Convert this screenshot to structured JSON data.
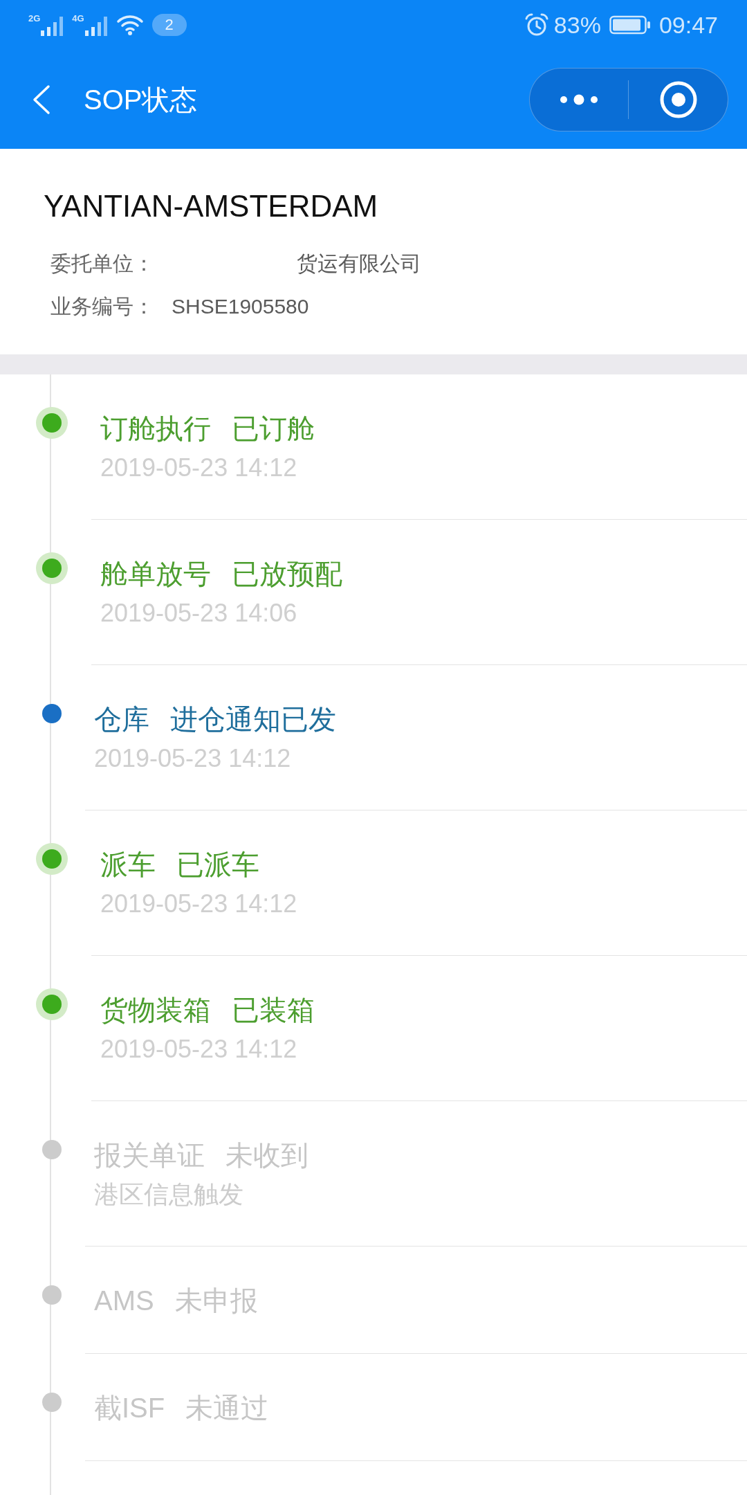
{
  "status_bar": {
    "networks": [
      {
        "label": "2G"
      },
      {
        "label": "4G"
      }
    ],
    "notification_count": "2",
    "battery": "83%",
    "time": "09:47"
  },
  "nav_bar": {
    "title": "SOP状态"
  },
  "shipment": {
    "route": "YANTIAN-AMSTERDAM",
    "fields": [
      {
        "label": "委托单位：",
        "value": "货运有限公司",
        "redacted": true
      },
      {
        "label": "业务编号：",
        "value": "SHSE1905580",
        "redacted": false
      }
    ]
  },
  "timeline": [
    {
      "kind": "done",
      "color": "#3dab1d",
      "step": "订舱执行",
      "status": "已订舱",
      "time": "2019-05-23 14:12"
    },
    {
      "kind": "done",
      "color": "#3dab1d",
      "step": "舱单放号",
      "status": "已放预配",
      "time": "2019-05-23 14:06"
    },
    {
      "kind": "active",
      "color": "#1a6fc4",
      "step": "仓库",
      "status": "进仓通知已发",
      "time": "2019-05-23 14:12"
    },
    {
      "kind": "done",
      "color": "#3dab1d",
      "step": "派车",
      "status": "已派车",
      "time": "2019-05-23 14:12"
    },
    {
      "kind": "done",
      "color": "#3dab1d",
      "step": "货物装箱",
      "status": "已装箱",
      "time": "2019-05-23 14:12"
    },
    {
      "kind": "pending",
      "color": "#cccccc",
      "step": "报关单证",
      "status": "未收到",
      "note": "港区信息触发"
    },
    {
      "kind": "pending",
      "color": "#cccccc",
      "step": "AMS",
      "status": "未申报"
    },
    {
      "kind": "pending",
      "color": "#cccccc",
      "step": "截ISF",
      "status": "未通过"
    }
  ]
}
